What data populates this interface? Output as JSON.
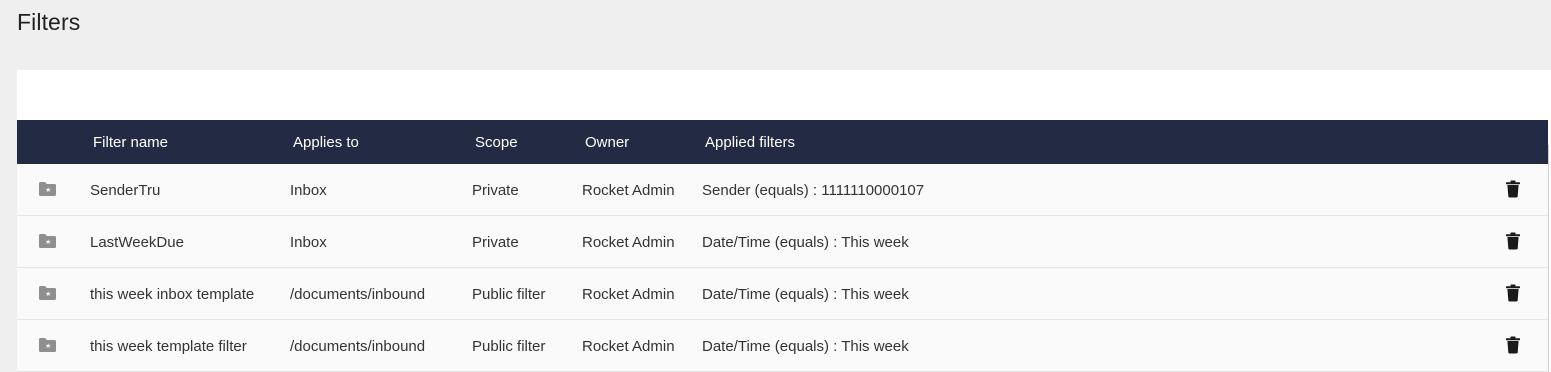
{
  "page": {
    "title": "Filters"
  },
  "table": {
    "columns": [
      "Filter name",
      "Applies to",
      "Scope",
      "Owner",
      "Applied filters"
    ],
    "rows": [
      {
        "name": "SenderTru",
        "applies_to": "Inbox",
        "scope": "Private",
        "owner": "Rocket Admin",
        "applied": "Sender (equals) : 1111110000107"
      },
      {
        "name": "LastWeekDue",
        "applies_to": "Inbox",
        "scope": "Private",
        "owner": "Rocket Admin",
        "applied": "Date/Time (equals) : This week"
      },
      {
        "name": "this week inbox template",
        "applies_to": "/documents/inbound",
        "scope": "Public filter",
        "owner": "Rocket Admin",
        "applied": "Date/Time (equals) : This week"
      },
      {
        "name": "this week template filter",
        "applies_to": "/documents/inbound",
        "scope": "Public filter",
        "owner": "Rocket Admin",
        "applied": "Date/Time (equals) : This week"
      }
    ]
  },
  "icons": {
    "row_icon": "folder-star-icon",
    "delete_icon": "trash-icon"
  },
  "colors": {
    "header_bg": "#232a43",
    "page_bg": "#efefef",
    "row_bg": "#fafafa"
  }
}
